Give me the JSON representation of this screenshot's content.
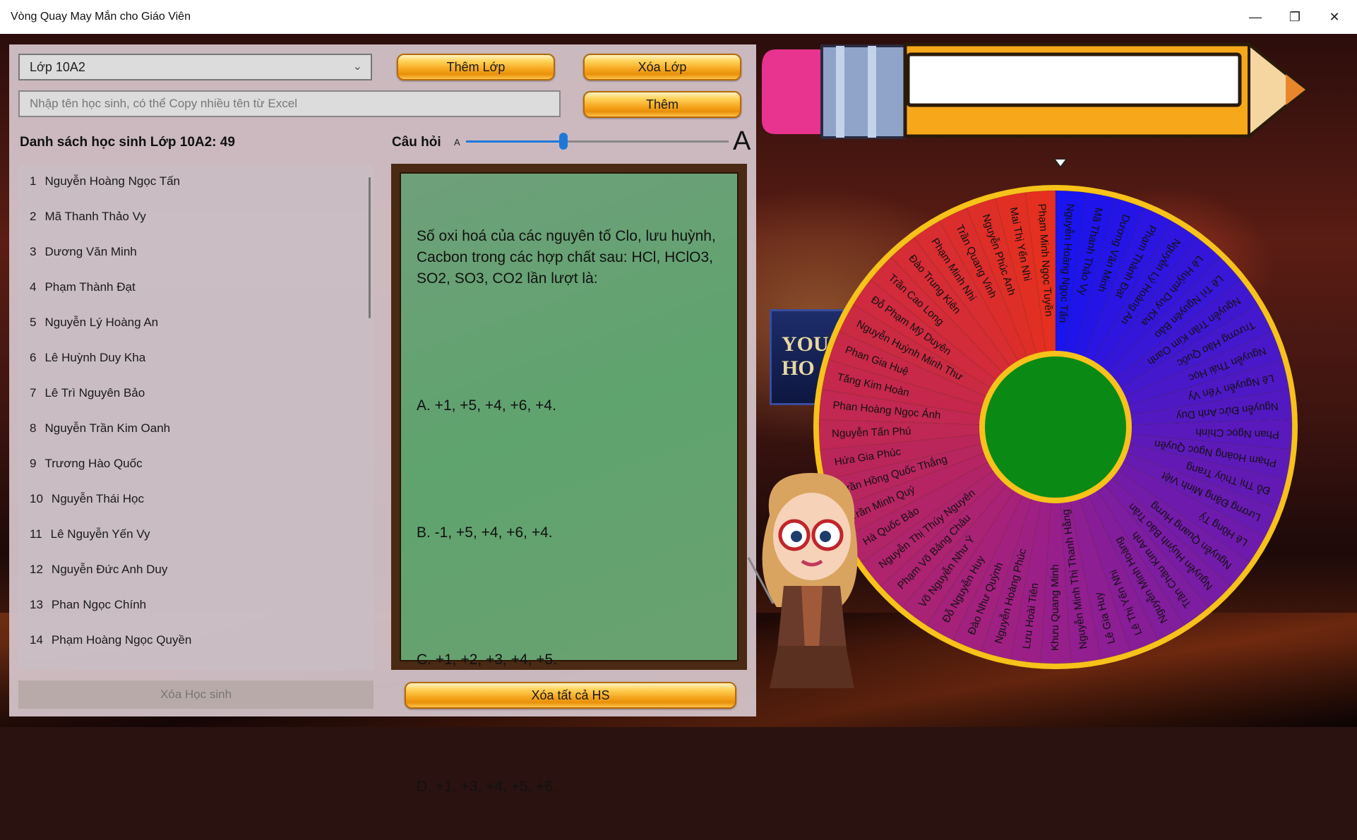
{
  "window": {
    "title": "Vòng Quay May Mắn cho Giáo Viên",
    "minimize": "—",
    "restore": "❐",
    "close": "✕"
  },
  "toolbar": {
    "class_select": "Lớp 10A2",
    "add_class": "Thêm Lớp",
    "delete_class": "Xóa Lớp",
    "student_input_placeholder": "Nhập tên học sinh, có thể Copy nhiều tên từ Excel",
    "add": "Thêm"
  },
  "students_heading": "Danh sách học sinh Lớp 10A2: 49",
  "question_heading": "Câu hỏi",
  "font_slider": {
    "small_label": "A",
    "large_label": "A",
    "value_fraction": 0.37
  },
  "students": [
    {
      "num": "1",
      "name": "Nguyễn Hoàng Ngọc Tấn"
    },
    {
      "num": "2",
      "name": "Mã Thanh Thảo Vy"
    },
    {
      "num": "3",
      "name": "Dương Văn Minh"
    },
    {
      "num": "4",
      "name": "Phạm Thành Đạt"
    },
    {
      "num": "5",
      "name": "Nguyễn Lý Hoàng An"
    },
    {
      "num": "6",
      "name": "Lê Huỳnh Duy Kha"
    },
    {
      "num": "7",
      "name": "Lê Trì Nguyên Bảo"
    },
    {
      "num": "8",
      "name": "Nguyễn Trần Kim Oanh"
    },
    {
      "num": "9",
      "name": "Trương Hào Quốc"
    },
    {
      "num": "10",
      "name": "Nguyễn Thái Học"
    },
    {
      "num": "11",
      "name": "Lê Nguyễn Yến Vy"
    },
    {
      "num": "12",
      "name": "Nguyễn Đức Anh Duy"
    },
    {
      "num": "13",
      "name": "Phan Ngọc Chính"
    },
    {
      "num": "14",
      "name": "Phạm Hoàng Ngọc Quyền"
    }
  ],
  "question": {
    "text": "Số oxi hoá của các nguyên tố Clo, lưu huỳnh, Cacbon trong các hợp chất sau: HCl, HClO3, SO2, SO3, CO2 lần lượt là:",
    "options": [
      "A. +1, +5, +4, +6, +4.",
      "B. -1, +5, +4, +6, +4.",
      "C. +1, +2, +3, +4, +5.",
      "D. +1, +3, +4, +5, +6."
    ]
  },
  "bottom": {
    "delete_student": "Xóa Học sinh",
    "delete_all": "Xóa tất cả HS"
  },
  "stage_sign": "YOU SHO",
  "wheel_names": [
    "Nguyễn Hoàng Ngọc Tấn",
    "Mã Thanh Thảo Vy",
    "Dương Văn Minh",
    "Phạm Thành Đạt",
    "Nguyễn Lý Hoàng An",
    "Lê Huỳnh Duy Kha",
    "Lê Trì Nguyên Bảo",
    "Nguyễn Trần Kim Oanh",
    "Trương Hào Quốc",
    "Nguyễn Thái Học",
    "Lê Nguyễn Yến Vy",
    "Nguyễn Đức Anh Duy",
    "Phan Ngọc Chính",
    "Phạm Hoàng Ngọc Quyền",
    "Đỗ Thị Thùy Trang",
    "Lương Đặng Minh Việt",
    "Lê Hồng Tý",
    "Nguyễn Quang Hưng",
    "Nguyễn Huỳnh Bảo Trân",
    "Trần Châu Kim Anh",
    "Nguyễn Minh Hoàng",
    "Lê Thị Yến Nhi",
    "Lê Gia Huy",
    "Nguyễn Minh Thị Thanh Hằng",
    "Khưu Quang Minh",
    "Lưu Hoài Tiên",
    "Nguyễn Hoàng Phúc",
    "Đào Như Quỳnh",
    "Đỗ Nguyễn Huy",
    "Võ Nguyễn Như Ý",
    "Phạm Võ Bảng Châu",
    "Nguyễn Thị Thúy Nguyên",
    "Hà Quốc Bảo",
    "Trần Minh Quý",
    "Trần Hồng Quốc Thắng",
    "Hứa Gia Phúc",
    "Nguyễn Tấn Phú",
    "Phan Hoàng Ngọc Ánh",
    "Tăng Kim Hoàn",
    "Phan Gia Huệ",
    "Nguyễn Huỳnh Minh Thư",
    "Đỗ Phạm Mỹ Duyên",
    "Trần Cao Long",
    "Đào Trung Kiên",
    "Phạm Minh Nhi",
    "Trần Quang Vinh",
    "Nguyễn Phúc Anh",
    "Mai Thị Yến Nhi",
    "Phạm Minh Ngọc Tuyền"
  ],
  "colors": {
    "wheel_red": "#e8301a",
    "wheel_purple": "#9a1f8a",
    "wheel_blue": "#1a14ee",
    "hub": "#0a8a14",
    "rim": "#f7c21a",
    "button_gold": "#f5a51d"
  }
}
